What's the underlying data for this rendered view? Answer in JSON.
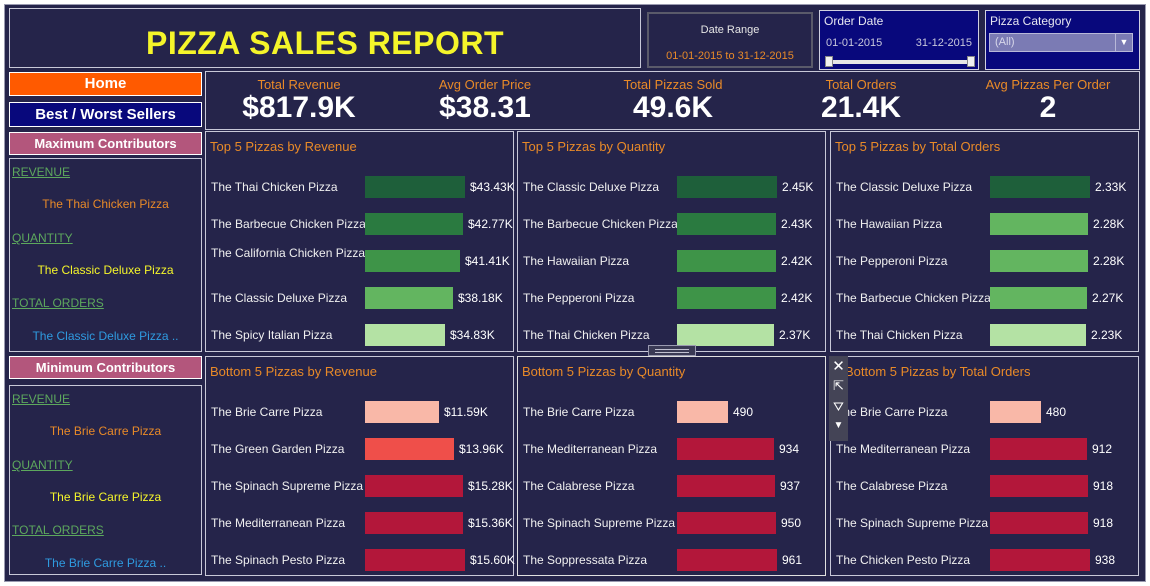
{
  "header": {
    "title": "PIZZA SALES REPORT",
    "date_range_label": "Date Range",
    "date_range_value": "01-01-2015 to 31-12-2015"
  },
  "filters": {
    "order_date": {
      "label": "Order Date",
      "from": "01-01-2015",
      "to": "31-12-2015"
    },
    "pizza_category": {
      "label": "Pizza Category",
      "selected": "(All)"
    }
  },
  "nav": {
    "home": "Home",
    "best_worst": "Best / Worst Sellers"
  },
  "kpis": [
    {
      "label": "Total Revenue",
      "value": "$817.9K"
    },
    {
      "label": "Avg Order Price",
      "value": "$38.31"
    },
    {
      "label": "Total Pizzas Sold",
      "value": "49.6K"
    },
    {
      "label": "Total Orders",
      "value": "21.4K"
    },
    {
      "label": "Avg Pizzas Per Order",
      "value": "2"
    }
  ],
  "max_contributors": {
    "title": "Maximum Contributors",
    "items": [
      {
        "heading": "REVENUE",
        "value": "The Thai Chicken Pizza",
        "color": "#e98a28"
      },
      {
        "heading": "QUANTITY",
        "value": "The Classic Deluxe Pizza",
        "color": "#f5f52a"
      },
      {
        "heading": "TOTAL ORDERS",
        "value": "The Classic Deluxe Pizza ..",
        "color": "#2f9be0"
      }
    ]
  },
  "min_contributors": {
    "title": "Minimum Contributors",
    "items": [
      {
        "heading": "REVENUE",
        "value": "The Brie Carre Pizza",
        "color": "#e98a28"
      },
      {
        "heading": "QUANTITY",
        "value": "The Brie Carre Pizza",
        "color": "#f5f52a"
      },
      {
        "heading": "TOTAL ORDERS",
        "value": "The Brie Carre Pizza ..",
        "color": "#2f9be0"
      }
    ]
  },
  "chart_data": [
    {
      "type": "bar",
      "title": "Top 5 Pizzas by Revenue",
      "categories": [
        "The Thai Chicken Pizza",
        "The Barbecue Chicken Pizza",
        "The California Chicken Pizza",
        "The Classic Deluxe Pizza",
        "The Spicy Italian Pizza"
      ],
      "values": [
        43430,
        42770,
        41410,
        38180,
        34830
      ],
      "labels": [
        "$43.43K",
        "$42.77K",
        "$41.41K",
        "$38.18K",
        "$34.83K"
      ],
      "colors": [
        "#1e5f3a",
        "#2a7a40",
        "#3e9448",
        "#63b560",
        "#b4e2a4"
      ]
    },
    {
      "type": "bar",
      "title": "Top 5 Pizzas by Quantity",
      "categories": [
        "The Classic Deluxe Pizza",
        "The Barbecue Chicken Pizza",
        "The Hawaiian Pizza",
        "The Pepperoni Pizza",
        "The Thai Chicken Pizza"
      ],
      "values": [
        2450,
        2430,
        2420,
        2420,
        2370
      ],
      "labels": [
        "2.45K",
        "2.43K",
        "2.42K",
        "2.42K",
        "2.37K"
      ],
      "colors": [
        "#1e5f3a",
        "#2a7a40",
        "#3e9448",
        "#3e9448",
        "#b4e2a4"
      ]
    },
    {
      "type": "bar",
      "title": "Top 5 Pizzas by Total Orders",
      "categories": [
        "The Classic Deluxe Pizza",
        "The Hawaiian Pizza",
        "The Pepperoni Pizza",
        "The Barbecue Chicken Pizza",
        "The Thai Chicken Pizza"
      ],
      "values": [
        2330,
        2280,
        2280,
        2270,
        2230
      ],
      "labels": [
        "2.33K",
        "2.28K",
        "2.28K",
        "2.27K",
        "2.23K"
      ],
      "colors": [
        "#1e5f3a",
        "#63b560",
        "#63b560",
        "#63b560",
        "#b4e2a4"
      ]
    },
    {
      "type": "bar",
      "title": "Bottom 5 Pizzas by Revenue",
      "categories": [
        "The Brie Carre Pizza",
        "The Green Garden Pizza",
        "The Spinach Supreme Pizza",
        "The Mediterranean Pizza",
        "The Spinach Pesto Pizza"
      ],
      "values": [
        11590,
        13960,
        15280,
        15360,
        15600
      ],
      "labels": [
        "$11.59K",
        "$13.96K",
        "$15.28K",
        "$15.36K",
        "$15.60K"
      ],
      "colors": [
        "#f9b8a8",
        "#ef4f4a",
        "#b3173a",
        "#b3173a",
        "#b3173a"
      ]
    },
    {
      "type": "bar",
      "title": "Bottom 5 Pizzas by Quantity",
      "categories": [
        "The Brie Carre Pizza",
        "The Mediterranean Pizza",
        "The Calabrese Pizza",
        "The Spinach Supreme Pizza",
        "The Soppressata Pizza"
      ],
      "values": [
        490,
        934,
        937,
        950,
        961
      ],
      "labels": [
        "490",
        "934",
        "937",
        "950",
        "961"
      ],
      "colors": [
        "#f9b8a8",
        "#b3173a",
        "#b3173a",
        "#b3173a",
        "#b3173a"
      ]
    },
    {
      "type": "bar",
      "title": "Bottom 5 Pizzas by Total Orders",
      "categories": [
        "The Brie Carre Pizza",
        "The Mediterranean Pizza",
        "The Calabrese Pizza",
        "The Spinach Supreme Pizza",
        "The Chicken Pesto Pizza"
      ],
      "values": [
        480,
        912,
        918,
        918,
        938
      ],
      "labels": [
        "480",
        "912",
        "918",
        "918",
        "938"
      ],
      "colors": [
        "#f9b8a8",
        "#b3173a",
        "#b3173a",
        "#b3173a",
        "#b3173a"
      ]
    }
  ],
  "toolbar": {
    "icons": [
      "close-icon",
      "pop-out-icon",
      "filter-icon",
      "dropdown-icon"
    ]
  }
}
